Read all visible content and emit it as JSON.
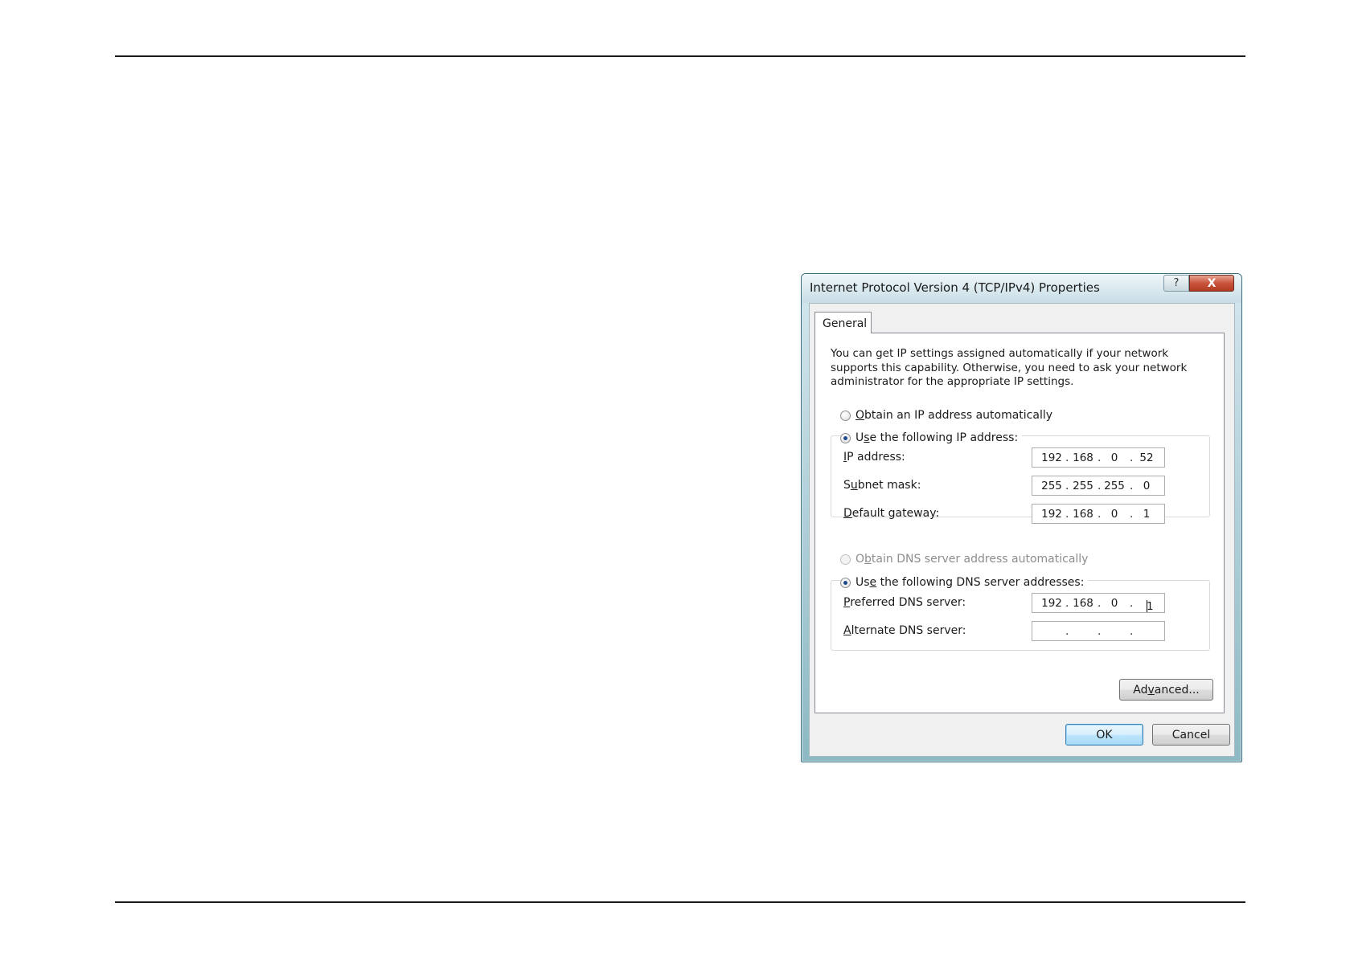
{
  "dialog": {
    "title": "Internet Protocol Version 4 (TCP/IPv4) Properties",
    "help_glyph": "?",
    "close_glyph": "X",
    "tab_label": "General",
    "description": "You can get IP settings assigned automatically if your network supports this capability. Otherwise, you need to ask your network administrator for the appropriate IP settings.",
    "ip_mode": {
      "auto_label_pre": "",
      "auto_label_key": "O",
      "auto_label_post": "btain an IP address automatically",
      "manual_label_pre": "U",
      "manual_label_key": "s",
      "manual_label_post": "e the following IP address:",
      "selected": "manual"
    },
    "ip_fields": {
      "ip_address": {
        "label_key": "I",
        "label_rest": "P address:",
        "octets": [
          "192",
          "168",
          "0",
          "52"
        ]
      },
      "subnet_mask": {
        "label_pre": "S",
        "label_key": "u",
        "label_rest": "bnet mask:",
        "octets": [
          "255",
          "255",
          "255",
          "0"
        ]
      },
      "default_gateway": {
        "label_key": "D",
        "label_rest": "efault gateway:",
        "octets": [
          "192",
          "168",
          "0",
          "1"
        ]
      }
    },
    "dns_mode": {
      "auto_label_pre": "O",
      "auto_label_key": "b",
      "auto_label_post": "tain DNS server address automatically",
      "manual_label_pre": "Us",
      "manual_label_key": "e",
      "manual_label_post": " the following DNS server addresses:",
      "selected": "manual",
      "auto_disabled": true
    },
    "dns_fields": {
      "preferred": {
        "label_key": "P",
        "label_rest": "referred DNS server:",
        "octets": [
          "192",
          "168",
          "0",
          "1"
        ]
      },
      "alternate": {
        "label_key": "A",
        "label_rest": "lternate DNS server:",
        "octets": [
          "",
          "",
          "",
          ""
        ]
      }
    },
    "ip_separator": ".",
    "advanced_button": {
      "pre": "Ad",
      "key": "v",
      "post": "anced..."
    },
    "ok_button": "OK",
    "cancel_button": "Cancel"
  },
  "colors": {
    "frame": "#8cb9c3",
    "close_button": "#c9543c",
    "radio_dot": "#1e4a8c"
  }
}
